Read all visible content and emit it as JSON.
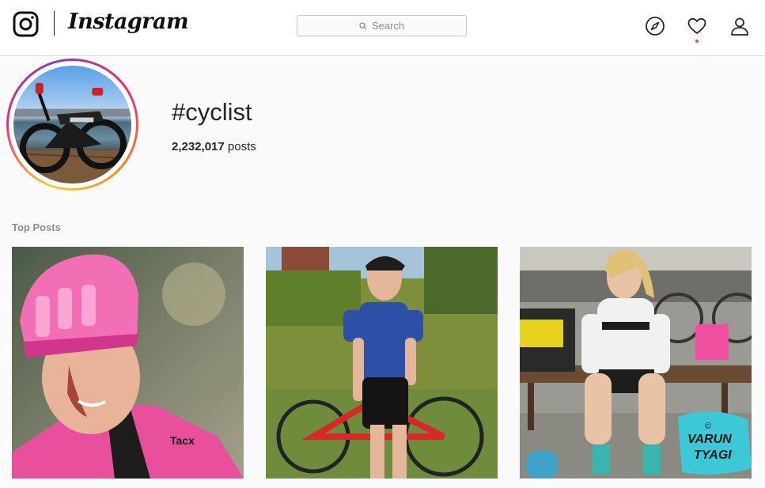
{
  "header": {
    "brand": "Instagram",
    "search_placeholder": "Search",
    "icons": [
      "instagram-logo-icon",
      "search-icon",
      "compass-icon",
      "heart-icon",
      "user-icon"
    ],
    "has_notification": true
  },
  "hashtag": {
    "title": "#cyclist",
    "post_count": "2,232,017",
    "post_label": "posts"
  },
  "section": {
    "top_posts_label": "Top Posts"
  },
  "posts": [
    {
      "name": "post-cyclist-pink-helmet"
    },
    {
      "name": "post-cyclist-blue-jersey"
    },
    {
      "name": "post-cyclist-white-kit",
      "watermark": "VARUN TYAGI"
    }
  ],
  "colors": {
    "notification": "#ed4956",
    "text": "#262626",
    "muted": "#8e8e8e",
    "border": "#dbdbdb"
  }
}
